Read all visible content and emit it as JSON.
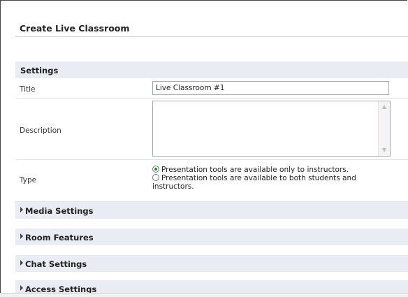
{
  "page": {
    "title": "Create Live Classroom"
  },
  "settings": {
    "header": "Settings",
    "title_label": "Title",
    "title_value": "Live Classroom #1",
    "description_label": "Description",
    "description_value": "",
    "type_label": "Type",
    "type_options": [
      {
        "label": "Presentation tools are available only to instructors.",
        "checked": true
      },
      {
        "label": "Presentation tools are available to both students and instructors.",
        "checked": false
      }
    ]
  },
  "sections": [
    {
      "label": "Media Settings"
    },
    {
      "label": "Room Features"
    },
    {
      "label": "Chat Settings"
    },
    {
      "label": "Access Settings"
    }
  ],
  "colors": {
    "section_header_bg": "#e9ecf2",
    "radio_selected": "#2a8a2a"
  },
  "icons": {
    "collapsed": "triangle-right-icon",
    "scroll_up": "arrow-up-icon",
    "scroll_down": "arrow-down-icon"
  }
}
